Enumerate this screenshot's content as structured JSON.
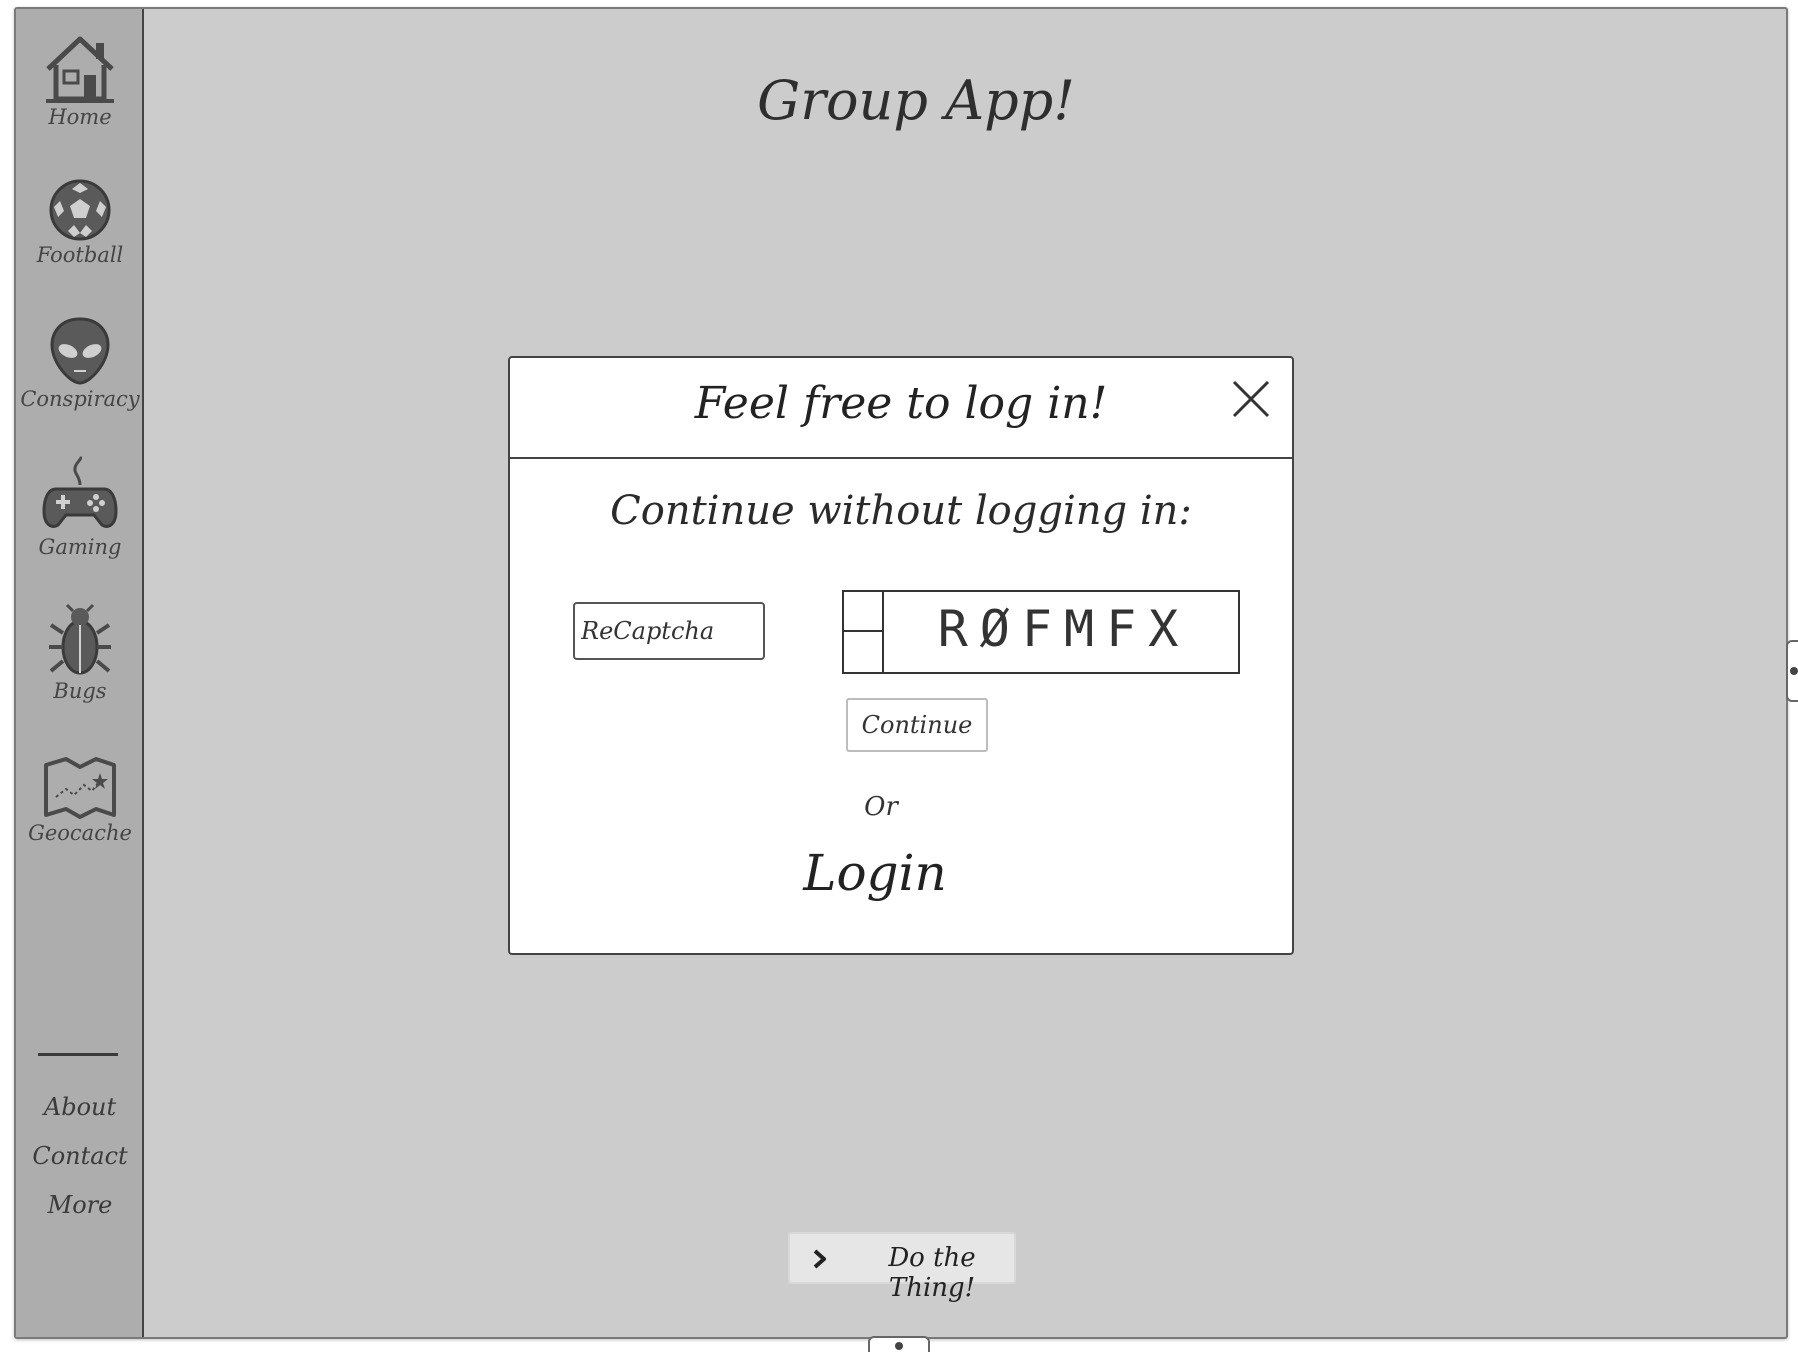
{
  "app": {
    "title": "Group App!"
  },
  "sidebar": {
    "items": [
      {
        "label": "Home",
        "icon": "home-icon"
      },
      {
        "label": "Football",
        "icon": "football-icon"
      },
      {
        "label": "Conspiracy",
        "icon": "alien-icon"
      },
      {
        "label": "Gaming",
        "icon": "gamepad-icon"
      },
      {
        "label": "Bugs",
        "icon": "bug-icon"
      },
      {
        "label": "Geocache",
        "icon": "map-icon"
      }
    ],
    "footer_links": [
      "About",
      "Contact",
      "More"
    ]
  },
  "modal": {
    "title": "Feel free to log in!",
    "close_icon": "close-icon",
    "continue_heading": "Continue without logging in:",
    "recaptcha_placeholder": "ReCaptcha",
    "captcha_text": "RØFMFX",
    "continue_button": "Continue",
    "or_text": "Or",
    "login_link": "Login"
  },
  "actions": {
    "do_thing_label": "Do the Thing!",
    "do_thing_icon": "chevron-right-icon"
  },
  "colors": {
    "canvas": "#cccccc",
    "sidebar": "#adadad",
    "modal_bg": "#ffffff",
    "ink": "#333333"
  }
}
